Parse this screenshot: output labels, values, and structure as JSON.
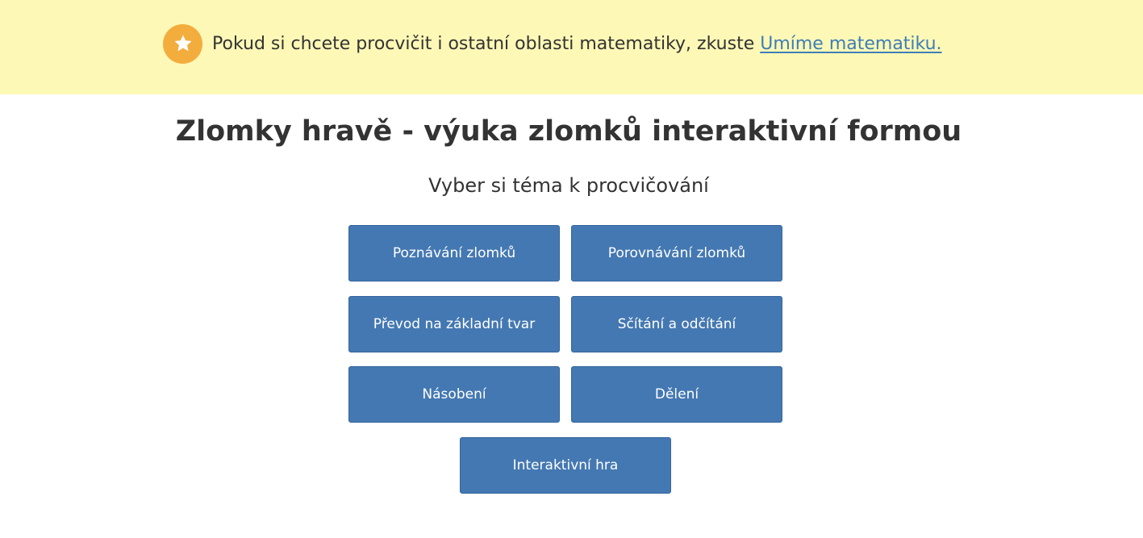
{
  "banner": {
    "icon": "star-icon",
    "text": "Pokud si chcete procvičit i ostatní oblasti matematiky, zkuste ",
    "link_text": "Umíme matematiku.",
    "colors": {
      "background": "#fdf8b6",
      "badge": "#f3ad3d",
      "link": "#3e7eb8"
    }
  },
  "title": {
    "bold": "Zlomky hravě",
    "rest": " - výuka zlomků interaktivní formou"
  },
  "subtitle": "Vyber si téma k procvičování",
  "topics": [
    "Poznávání zlomků",
    "Porovnávání zlomků",
    "Převod na základní tvar",
    "Sčítání a odčítání",
    "Násobení",
    "Dělení",
    "Interaktivní hra"
  ],
  "colors": {
    "button": "#4478b2",
    "text": "#333333"
  }
}
